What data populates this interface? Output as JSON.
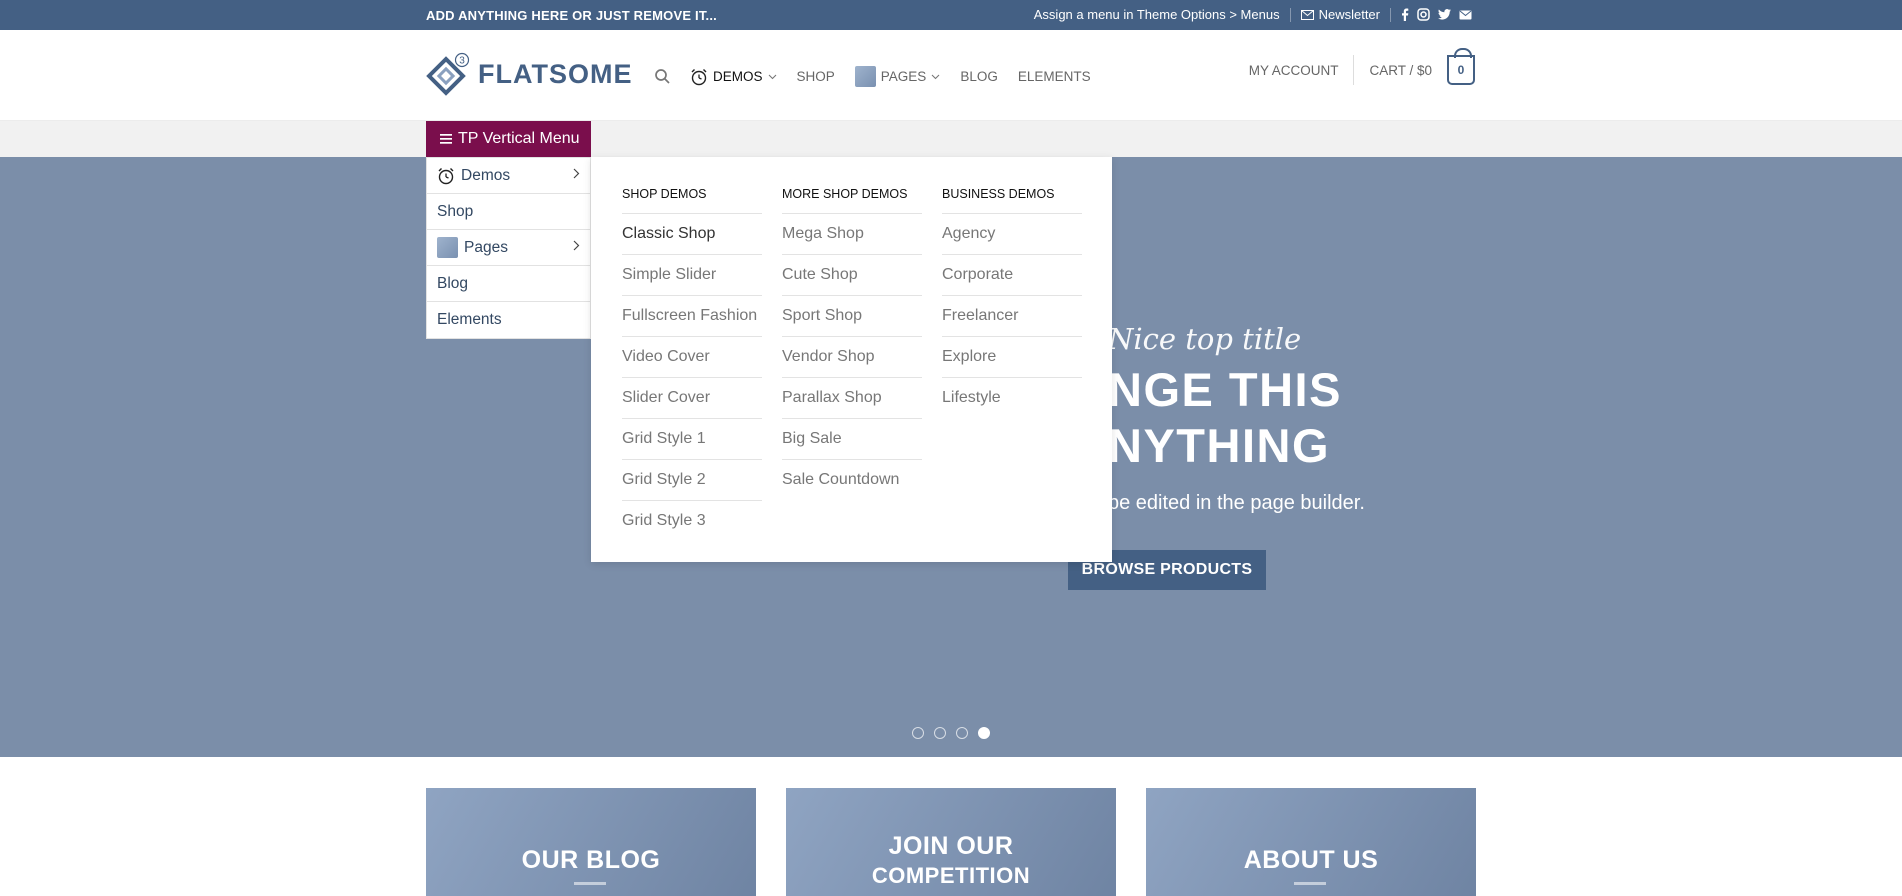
{
  "topbar": {
    "left_text": "ADD ANYTHING HERE OR JUST REMOVE IT...",
    "menu_hint": "Assign a menu in Theme Options > Menus",
    "newsletter": "Newsletter"
  },
  "header": {
    "logo_text": "FLATSOME",
    "logo_badge": "3",
    "nav": [
      "DEMOS",
      "SHOP",
      "PAGES",
      "BLOG",
      "ELEMENTS"
    ],
    "account": "MY ACCOUNT",
    "cart": "CART / $0",
    "cart_count": "0"
  },
  "vertical_menu": {
    "button_label": "TP Vertical Menu",
    "items": [
      "Demos",
      "Shop",
      "Pages",
      "Blog",
      "Elements"
    ]
  },
  "mega_menu": {
    "columns": [
      {
        "heading": "SHOP DEMOS",
        "links": [
          "Classic Shop",
          "Simple Slider",
          "Fullscreen Fashion",
          "Video Cover",
          "Slider Cover",
          "Grid Style 1",
          "Grid Style 2",
          "Grid Style 3"
        ]
      },
      {
        "heading": "MORE SHOP DEMOS",
        "links": [
          "Mega Shop",
          "Cute Shop",
          "Sport Shop",
          "Vendor Shop",
          "Parallax Shop",
          "Big Sale",
          "Sale Countdown"
        ]
      },
      {
        "heading": "BUSINESS DEMOS",
        "links": [
          "Agency",
          "Corporate",
          "Freelancer",
          "Explore",
          "Lifestyle"
        ]
      }
    ]
  },
  "hero": {
    "kicker": "Nice top title",
    "headline_1": "NGE THIS",
    "headline_2": "NYTHING",
    "subtitle": "be edited in the page builder.",
    "button": "BROWSE PRODUCTS",
    "active_slide": 4,
    "slide_count": 4
  },
  "boxes": [
    {
      "title_1": "OUR BLOG",
      "title_2": ""
    },
    {
      "title_1": "JOIN OUR",
      "title_2": "COMPETITION"
    },
    {
      "title_1": "ABOUT US",
      "title_2": ""
    }
  ],
  "colors": {
    "primary": "#446084",
    "vertical_menu": "#7a0e4c",
    "hero_bg": "#7b8ea9"
  }
}
